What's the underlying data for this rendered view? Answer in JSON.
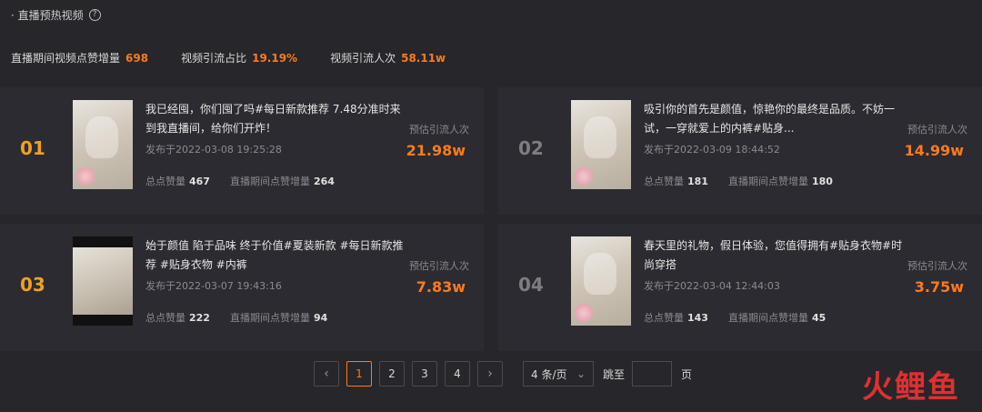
{
  "header": {
    "title": "· 直播预热视频"
  },
  "stats": [
    {
      "label": "直播期间视频点赞增量",
      "value": "698"
    },
    {
      "label": "视频引流占比",
      "value": "19.19%"
    },
    {
      "label": "视频引流人次",
      "value": "58.11w"
    }
  ],
  "cards": [
    {
      "rank": "01",
      "title": "我已经囤，你们囤了吗#每日新款推荐 7.48分准时来到我直播间，给你们开炸！",
      "date": "发布于2022-03-08 19:25:28",
      "likes_label": "总点赞量",
      "likes": "467",
      "live_likes_label": "直播期间点赞增量",
      "live_likes": "264",
      "est_label": "预估引流人次",
      "est_value": "21.98w"
    },
    {
      "rank": "02",
      "title": "吸引你的首先是颜值，惊艳你的最终是品质。不妨一试，一穿就爱上的内裤#贴身...",
      "date": "发布于2022-03-09 18:44:52",
      "likes_label": "总点赞量",
      "likes": "181",
      "live_likes_label": "直播期间点赞增量",
      "live_likes": "180",
      "est_label": "预估引流人次",
      "est_value": "14.99w"
    },
    {
      "rank": "03",
      "title": "始于颜值 陷于品味 终于价值#夏装新款 #每日新款推荐 #贴身衣物 #内裤",
      "date": "发布于2022-03-07 19:43:16",
      "likes_label": "总点赞量",
      "likes": "222",
      "live_likes_label": "直播期间点赞增量",
      "live_likes": "94",
      "est_label": "预估引流人次",
      "est_value": "7.83w"
    },
    {
      "rank": "04",
      "title": "春天里的礼物，假日体验，您值得拥有#贴身衣物#时尚穿搭",
      "date": "发布于2022-03-04 12:44:03",
      "likes_label": "总点赞量",
      "likes": "143",
      "live_likes_label": "直播期间点赞增量",
      "live_likes": "45",
      "est_label": "预估引流人次",
      "est_value": "3.75w"
    }
  ],
  "pagination": {
    "prev": "‹",
    "next": "›",
    "pages": [
      "1",
      "2",
      "3",
      "4"
    ],
    "current": "1",
    "page_size": "4 条/页",
    "jump_label": "跳至",
    "page_unit": "页"
  },
  "logo": "火鲤鱼",
  "colors": {
    "accent": "#ff7a1a",
    "rank_top": "#f0a020",
    "background": "#26262b"
  }
}
